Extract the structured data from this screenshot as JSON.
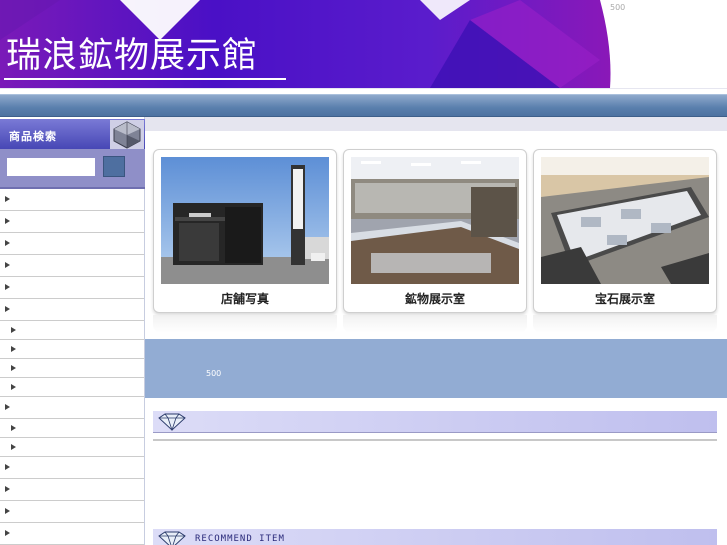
{
  "header": {
    "site_title": "瑞浪鉱物展示館",
    "counter": "500"
  },
  "sidebar": {
    "search_title": "商品検索",
    "search": {
      "value": "",
      "placeholder": ""
    },
    "menu_items": [
      {
        "label": "",
        "level": 1
      },
      {
        "label": "",
        "level": 1
      },
      {
        "label": "",
        "level": 1
      },
      {
        "label": "",
        "level": 1
      },
      {
        "label": "",
        "level": 1
      },
      {
        "label": "",
        "level": 1
      },
      {
        "label": "",
        "level": 2
      },
      {
        "label": "",
        "level": 2
      },
      {
        "label": "",
        "level": 2
      },
      {
        "label": "",
        "level": 2
      },
      {
        "label": "",
        "level": 1
      },
      {
        "label": "",
        "level": 2
      },
      {
        "label": "",
        "level": 2
      },
      {
        "label": "",
        "level": 1
      },
      {
        "label": "",
        "level": 1
      },
      {
        "label": "",
        "level": 1
      },
      {
        "label": "",
        "level": 1
      }
    ]
  },
  "main": {
    "cards": [
      {
        "label": "店舗写真",
        "photo_icon": "store-building-photo"
      },
      {
        "label": "鉱物展示室",
        "photo_icon": "mineral-showroom-photo"
      },
      {
        "label": "宝石展示室",
        "photo_icon": "gem-showroom-photo"
      }
    ],
    "info_counter": "500",
    "sections": [
      {
        "title": ""
      },
      {
        "title": "RECOMMEND  ITEM"
      }
    ]
  },
  "colors": {
    "header_purple": "#5a16c8",
    "header_magenta": "#8a18b8",
    "nav_blue": "#5a7fad",
    "info_band": "#92acd3",
    "section_header": "#c8c8f2"
  }
}
